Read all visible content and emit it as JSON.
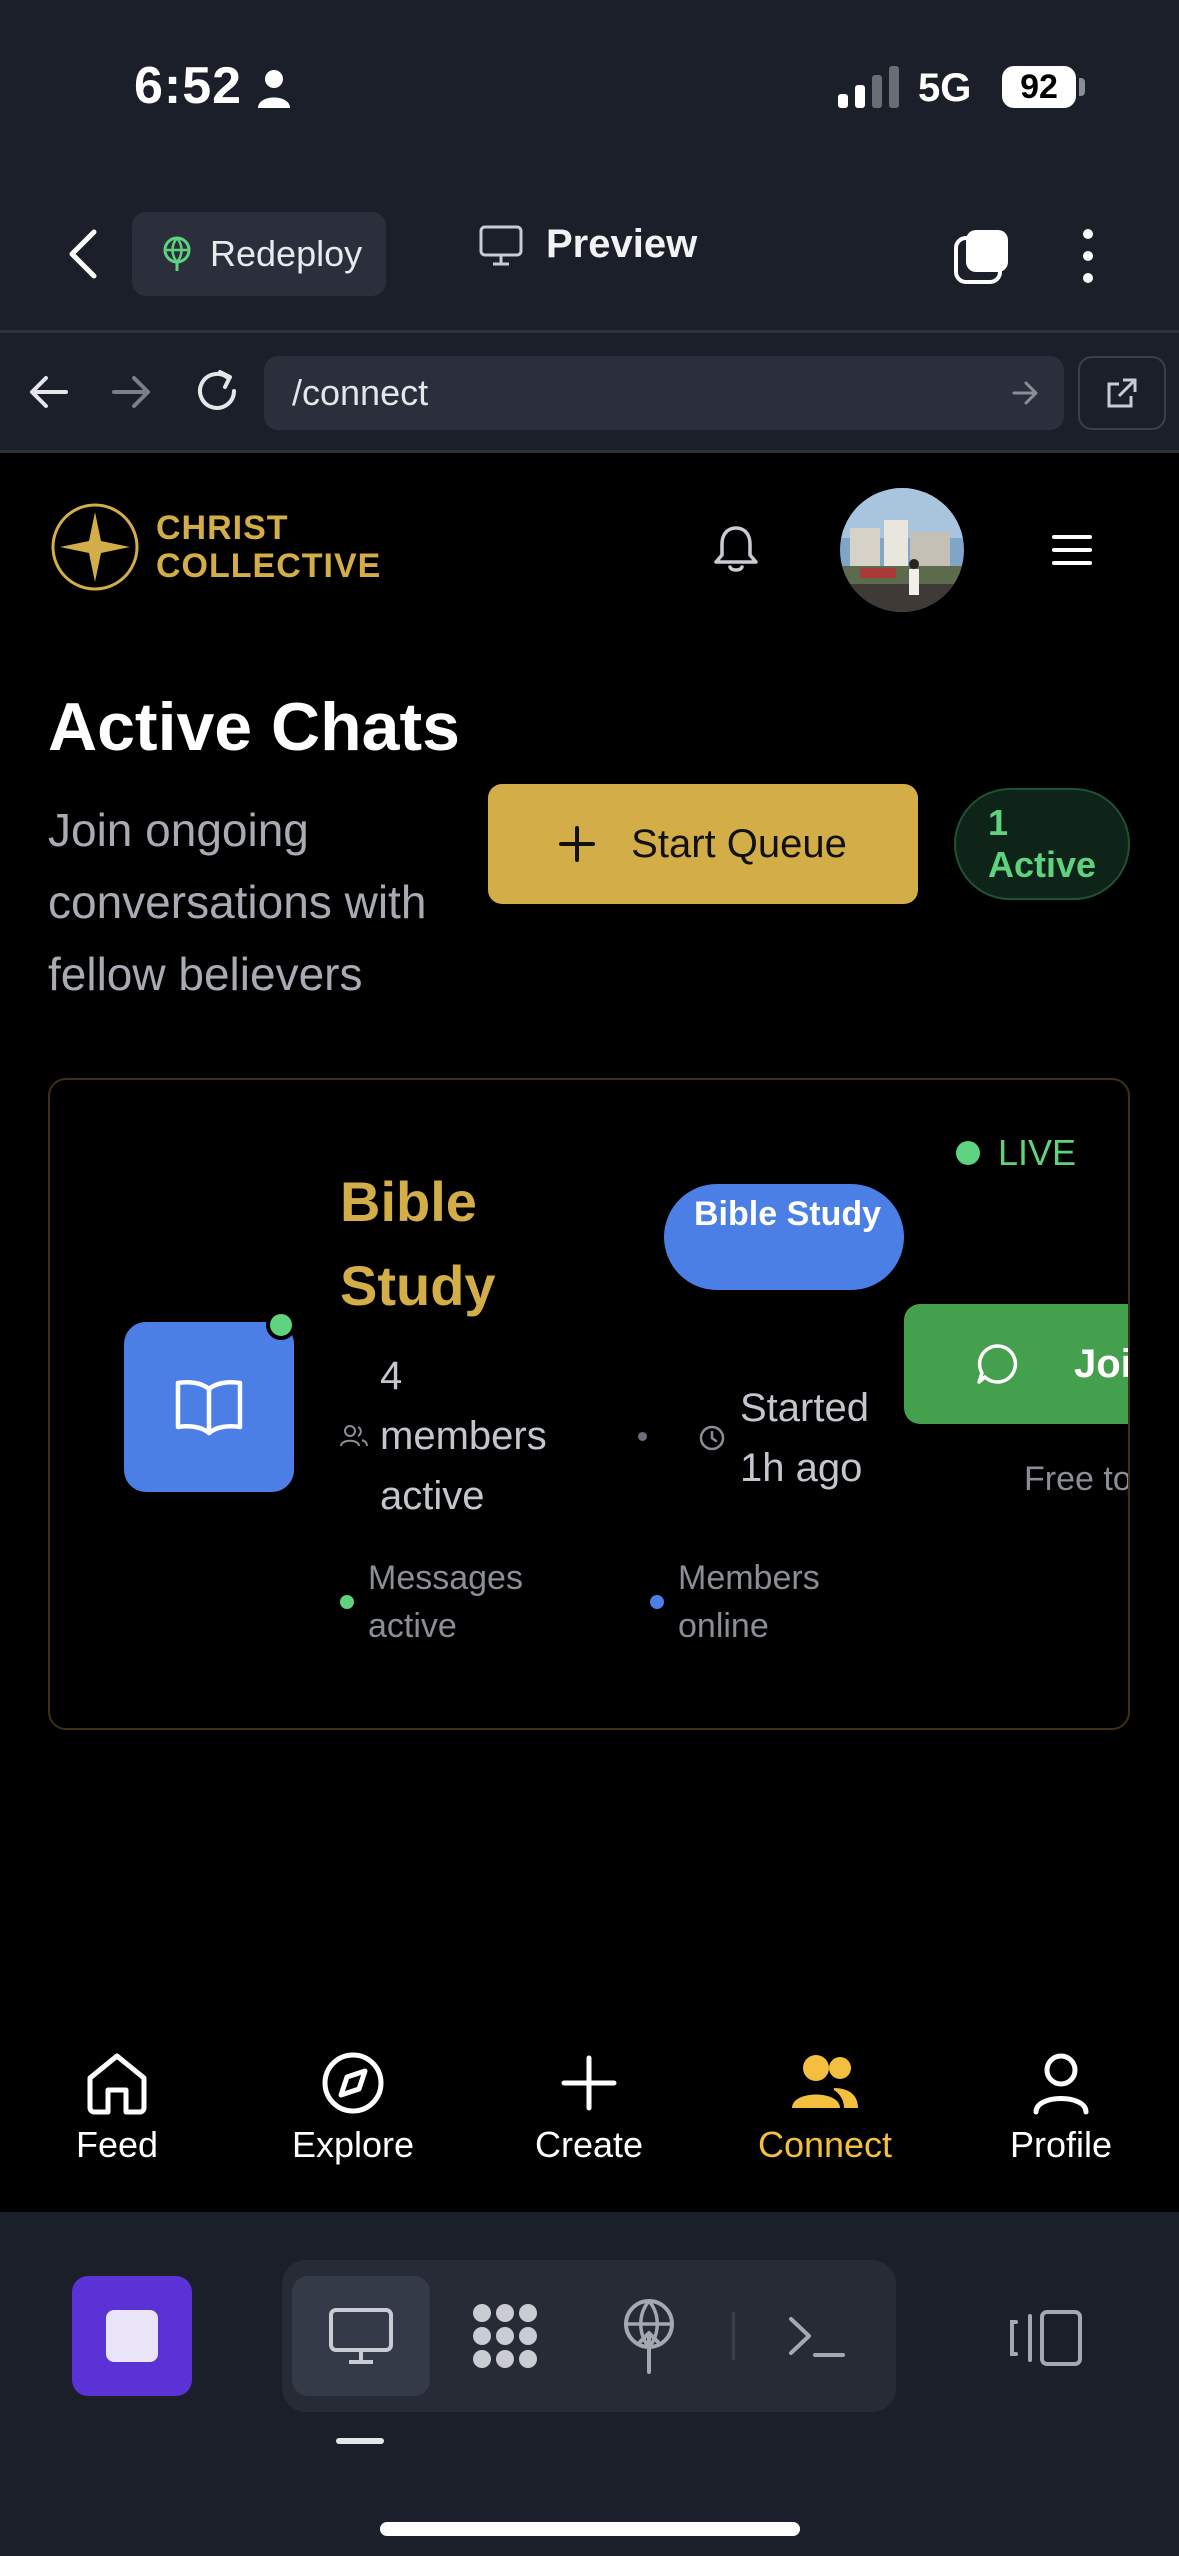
{
  "status_bar": {
    "time": "6:52",
    "network": "5G",
    "battery": "92"
  },
  "replit_header": {
    "redeploy_label": "Redeploy",
    "preview_label": "Preview"
  },
  "browser": {
    "url": "/connect"
  },
  "app": {
    "brand_line1": "CHRIST",
    "brand_line2": "COLLECTIVE",
    "page_title": "Active Chats",
    "subtitle": "Join ongoing conversations with fellow believers",
    "start_queue_label": "Start Queue",
    "active_count": "1",
    "active_label": "Active",
    "chat_card": {
      "title": "Bible Study",
      "tag": "Bible Study",
      "live_label": "LIVE",
      "members_text": "4 members active",
      "started_text": "Started 1h ago",
      "join_label": "Join",
      "free_text": "Free to",
      "legend_messages": "Messages active",
      "legend_members": "Members online"
    }
  },
  "tabbar": {
    "items": [
      {
        "label": "Feed",
        "icon": "home-icon"
      },
      {
        "label": "Explore",
        "icon": "compass-icon"
      },
      {
        "label": "Create",
        "icon": "plus-icon"
      },
      {
        "label": "Connect",
        "icon": "users-icon",
        "active": true
      },
      {
        "label": "Profile",
        "icon": "user-icon"
      }
    ]
  },
  "colors": {
    "gold": "#d3ad47",
    "green": "#5ed27f",
    "blue": "#4b7fe6",
    "join_green": "#44a04d",
    "active_tab": "#f4be3e",
    "chrome": "#1b1f2a",
    "stop_purple": "#5b32d6"
  }
}
